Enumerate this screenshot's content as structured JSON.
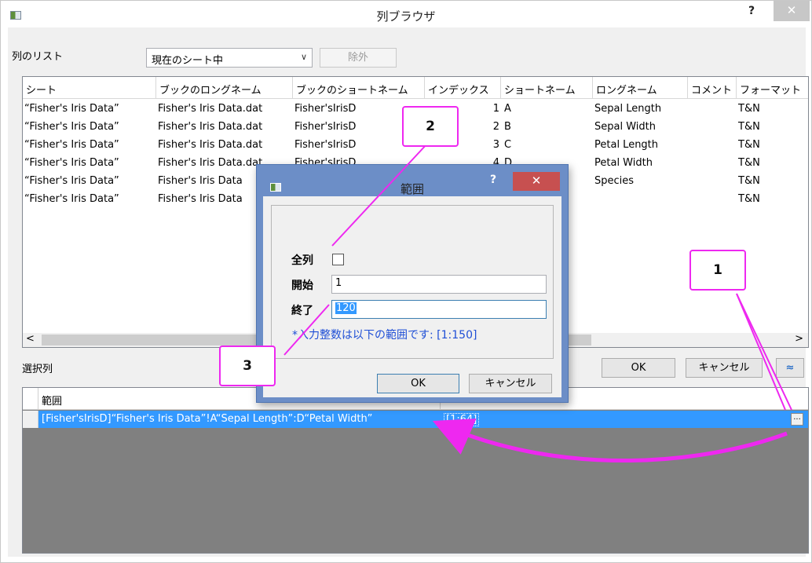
{
  "window": {
    "title": "列ブラウザ",
    "help": "?",
    "close": "✕"
  },
  "toolbar": {
    "list_label": "列のリスト",
    "scope_value": "現在のシート中",
    "scope_arrow": "∨",
    "remove_label": "除外"
  },
  "listview": {
    "headers": [
      "シート",
      "ブックのロングネーム",
      "ブックのショートネーム",
      "インデックス",
      "ショートネーム",
      "ロングネーム",
      "コメント",
      "フォーマット"
    ],
    "rows": [
      [
        "“Fisher's Iris Data”",
        "Fisher's Iris Data.dat",
        "Fisher'sIrisD",
        "1",
        "A",
        "Sepal Length",
        "",
        "T&N"
      ],
      [
        "“Fisher's Iris Data”",
        "Fisher's Iris Data.dat",
        "Fisher'sIrisD",
        "2",
        "B",
        "Sepal Width",
        "",
        "T&N"
      ],
      [
        "“Fisher's Iris Data”",
        "Fisher's Iris Data.dat",
        "Fisher'sIrisD",
        "3",
        "C",
        "Petal Length",
        "",
        "T&N"
      ],
      [
        "“Fisher's Iris Data”",
        "Fisher's Iris Data.dat",
        "Fisher'sIrisD",
        "4",
        "D",
        "Petal Width",
        "",
        "T&N"
      ],
      [
        "“Fisher's Iris Data”",
        "Fisher's Iris Data",
        "",
        "",
        "",
        "Species",
        "",
        "T&N"
      ],
      [
        "“Fisher's Iris Data”",
        "Fisher's Iris Data",
        "",
        "",
        "",
        "",
        "",
        "T&N"
      ]
    ],
    "scroll_left": "<",
    "scroll_right": ">"
  },
  "selected": {
    "label": "選択列",
    "ok": "OK",
    "cancel": "キャンセル",
    "collapse": "≈"
  },
  "grid": {
    "header": "範囲",
    "row_text": "[Fisher'sIrisD]“Fisher's Iris Data”!A“Sepal Length”:D“Petal Width”",
    "row_value": "[1:64]",
    "ellipsis": "..."
  },
  "dialog": {
    "title": "範囲",
    "help": "?",
    "close": "✕",
    "all_cols_label": "全列",
    "start_label": "開始",
    "start_value": "1",
    "end_label": "終了",
    "end_value": "120",
    "hint": "*入力整数は以下の範囲です: [1:150]",
    "ok": "OK",
    "cancel": "キャンセル"
  },
  "callouts": {
    "one": "1",
    "two": "2",
    "three": "3"
  },
  "colors": {
    "annotation": "#ee28f0",
    "selection": "#3399ff",
    "dialog_frame": "#6c8ec7",
    "close_red": "#c75050"
  }
}
